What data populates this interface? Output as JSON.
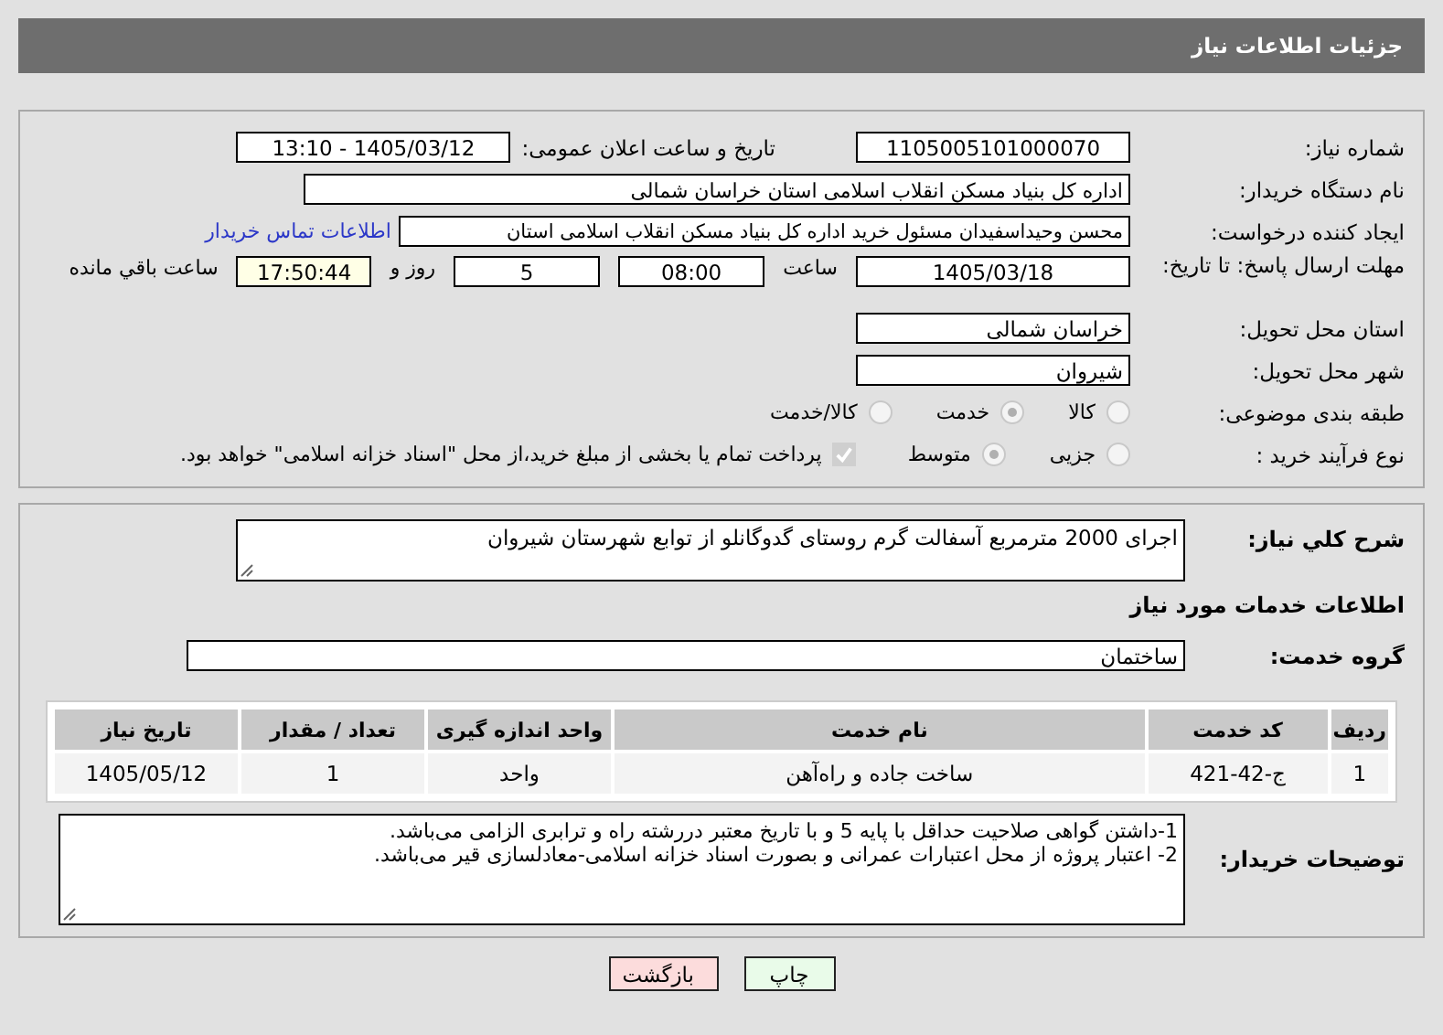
{
  "page_title": "جزئیات اطلاعات نیاز",
  "need_number": {
    "label": "شماره نیاز:",
    "value": "1105005101000070"
  },
  "announce": {
    "label": "تاریخ و ساعت اعلان عمومی:",
    "value": "1405/03/12 - 13:10"
  },
  "buyer_org": {
    "label": "نام دستگاه خریدار:",
    "value": "اداره کل بنیاد مسکن انقلاب اسلامی استان خراسان شمالی"
  },
  "creator": {
    "label": "ایجاد کننده درخواست:",
    "value": "محسن وحیداسفیدان مسئول خرید اداره کل بنیاد مسکن انقلاب اسلامی استان",
    "link": "اطلاعات تماس خریدار"
  },
  "deadline": {
    "label": "مهلت ارسال پاسخ: تا تاریخ:",
    "date": "1405/03/18",
    "time_label": "ساعت",
    "time": "08:00",
    "days": "5",
    "days_label": "روز و",
    "remaining": "17:50:44",
    "remaining_label": "ساعت باقي مانده"
  },
  "province": {
    "label": "استان محل تحویل:",
    "value": "خراسان شمالی"
  },
  "city": {
    "label": "شهر محل تحویل:",
    "value": "شیروان"
  },
  "category": {
    "label": "طبقه بندی موضوعی:",
    "options": [
      {
        "label": "کالا",
        "selected": false
      },
      {
        "label": "خدمت",
        "selected": true
      },
      {
        "label": "کالا/خدمت",
        "selected": false
      }
    ]
  },
  "process": {
    "label": "نوع فرآیند خرید :",
    "options": [
      {
        "label": "جزیی",
        "selected": false
      },
      {
        "label": "متوسط",
        "selected": true
      }
    ],
    "treasury": {
      "checked": true,
      "text": "پرداخت تمام یا بخشی از مبلغ خرید،از محل \"اسناد خزانه اسلامی\" خواهد بود."
    }
  },
  "description": {
    "label": "شرح کلي نياز:",
    "value": "اجرای 2000 مترمربع آسفالت گرم روستای گدوگانلو از توابع شهرستان شیروان"
  },
  "services_heading": "اطلاعات خدمات مورد نیاز",
  "service_group": {
    "label": "گروه خدمت:",
    "value": "ساختمان"
  },
  "table": {
    "columns": [
      "ردیف",
      "کد خدمت",
      "نام خدمت",
      "واحد اندازه گیری",
      "تعداد / مقدار",
      "تاریخ نیاز"
    ],
    "rows": [
      [
        "1",
        "ج-42-421",
        "ساخت جاده و راه‌آهن",
        "واحد",
        "1",
        "1405/05/12"
      ]
    ]
  },
  "notes": {
    "label": "توضیحات خریدار:",
    "lines": [
      "1-داشتن گواهی صلاحیت حداقل با پایه 5 و با تاریخ معتبر دررشته راه و ترابری الزامی می‌باشد.",
      "2- اعتبار پروژه از محل اعتبارات عمرانی و بصورت اسناد خزانه اسلامی-معادلسازی قیر می‌باشد."
    ]
  },
  "buttons": [
    {
      "label": "چاپ",
      "kind": "print"
    },
    {
      "label": "بازگشت",
      "kind": "back"
    }
  ]
}
